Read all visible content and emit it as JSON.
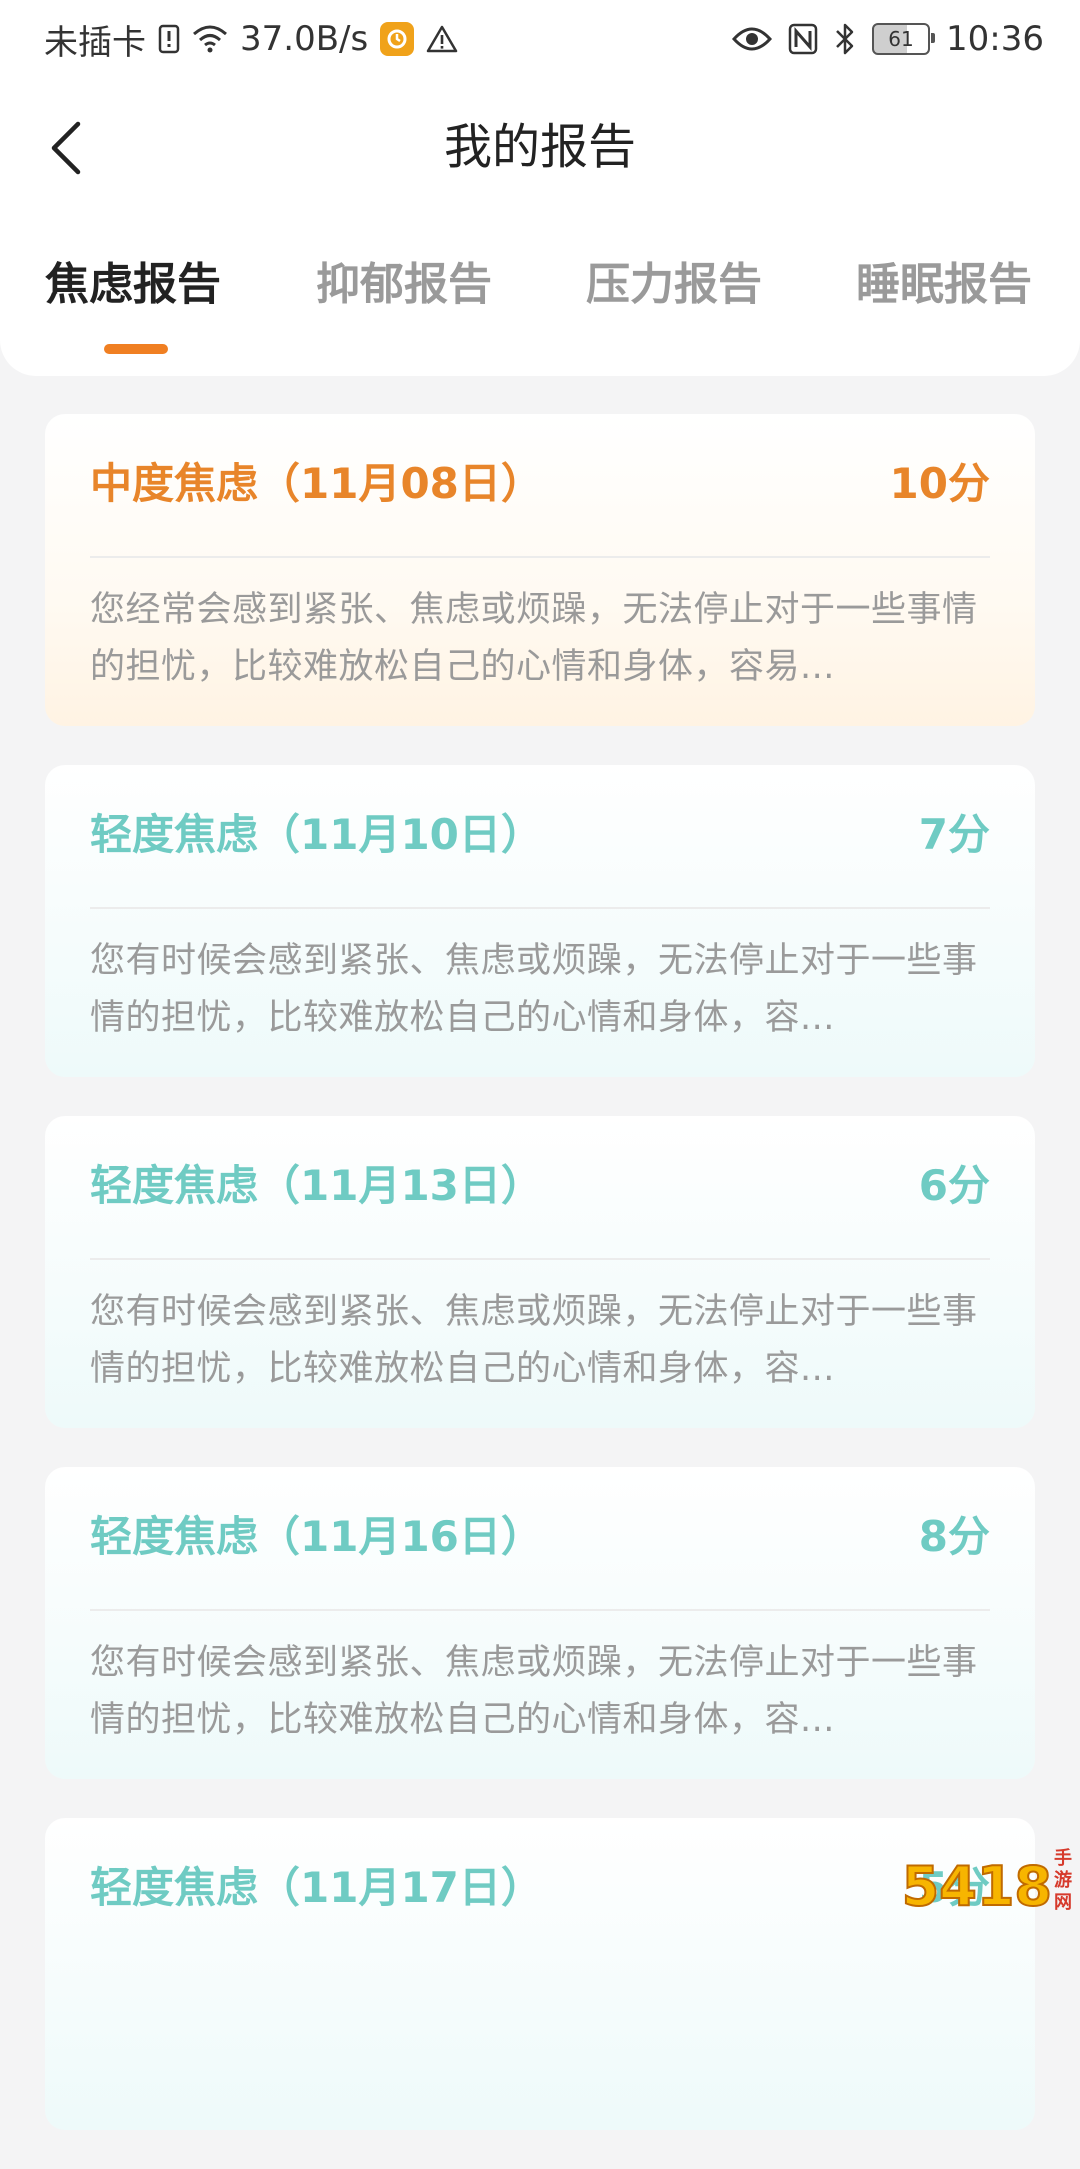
{
  "status_bar": {
    "carrier": "未插卡",
    "network_speed": "37.0B/s",
    "battery": "61",
    "time": "10:36",
    "icons": [
      "sim-alert-icon",
      "wifi-icon",
      "clock-app-icon",
      "warning-icon",
      "eye-icon",
      "nfc-icon",
      "bluetooth-icon",
      "battery-icon"
    ]
  },
  "header": {
    "title": "我的报告",
    "back_icon": "chevron-left-icon"
  },
  "tabs": [
    {
      "label": "焦虑报告",
      "active": true
    },
    {
      "label": "抑郁报告",
      "active": false
    },
    {
      "label": "压力报告",
      "active": false
    },
    {
      "label": "睡眠报告",
      "active": false
    }
  ],
  "colors": {
    "accent": "#f07f22",
    "moderate": "#e8852a",
    "mild": "#6fcbc3",
    "text_muted": "#9a9a9a"
  },
  "reports": [
    {
      "title": "中度焦虑（11月08日）",
      "score": "10分",
      "level": "moderate",
      "desc": "您经常会感到紧张、焦虑或烦躁，无法停止对于一些事情的担忧，比较难放松自己的心情和身体，容易..."
    },
    {
      "title": "轻度焦虑（11月10日）",
      "score": "7分",
      "level": "mild",
      "desc": "您有时候会感到紧张、焦虑或烦躁，无法停止对于一些事情的担忧，比较难放松自己的心情和身体，容..."
    },
    {
      "title": "轻度焦虑（11月13日）",
      "score": "6分",
      "level": "mild",
      "desc": "您有时候会感到紧张、焦虑或烦躁，无法停止对于一些事情的担忧，比较难放松自己的心情和身体，容..."
    },
    {
      "title": "轻度焦虑（11月16日）",
      "score": "8分",
      "level": "mild",
      "desc": "您有时候会感到紧张、焦虑或烦躁，无法停止对于一些事情的担忧，比较难放松自己的心情和身体，容..."
    },
    {
      "title": "轻度焦虑（11月17日）",
      "score": "5分",
      "level": "mild",
      "desc": ""
    }
  ],
  "watermark": {
    "num": "5418",
    "text": "手游网"
  }
}
